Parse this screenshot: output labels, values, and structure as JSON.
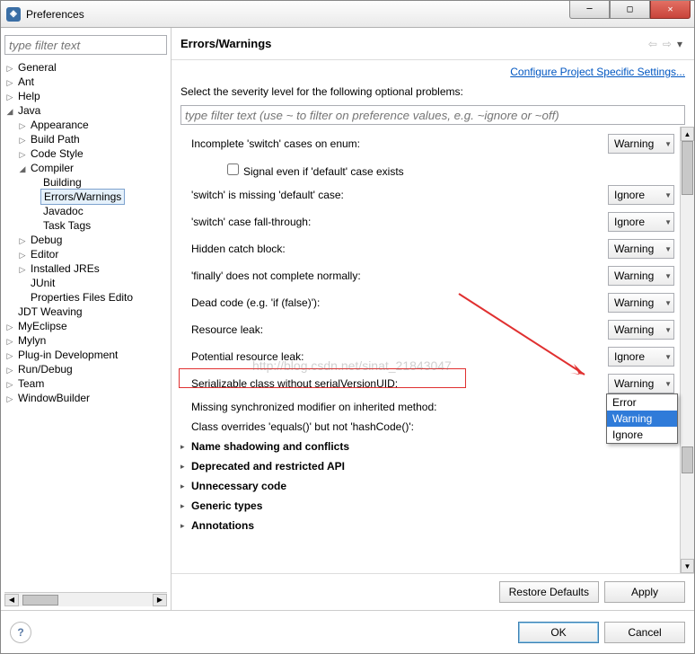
{
  "window": {
    "title": "Preferences"
  },
  "sidebar": {
    "filter_placeholder": "type filter text",
    "items": [
      {
        "label": "General",
        "twisty": "▷",
        "indent": 0
      },
      {
        "label": "Ant",
        "twisty": "▷",
        "indent": 0
      },
      {
        "label": "Help",
        "twisty": "▷",
        "indent": 0
      },
      {
        "label": "Java",
        "twisty": "◢",
        "indent": 0
      },
      {
        "label": "Appearance",
        "twisty": "▷",
        "indent": 1
      },
      {
        "label": "Build Path",
        "twisty": "▷",
        "indent": 1
      },
      {
        "label": "Code Style",
        "twisty": "▷",
        "indent": 1
      },
      {
        "label": "Compiler",
        "twisty": "◢",
        "indent": 1
      },
      {
        "label": "Building",
        "twisty": "",
        "indent": 2
      },
      {
        "label": "Errors/Warnings",
        "twisty": "",
        "indent": 2,
        "selected": true
      },
      {
        "label": "Javadoc",
        "twisty": "",
        "indent": 2
      },
      {
        "label": "Task Tags",
        "twisty": "",
        "indent": 2
      },
      {
        "label": "Debug",
        "twisty": "▷",
        "indent": 1
      },
      {
        "label": "Editor",
        "twisty": "▷",
        "indent": 1
      },
      {
        "label": "Installed JREs",
        "twisty": "▷",
        "indent": 1
      },
      {
        "label": "JUnit",
        "twisty": "",
        "indent": 1
      },
      {
        "label": "Properties Files Edito",
        "twisty": "",
        "indent": 1
      },
      {
        "label": "JDT Weaving",
        "twisty": "",
        "indent": 0
      },
      {
        "label": "MyEclipse",
        "twisty": "▷",
        "indent": 0
      },
      {
        "label": "Mylyn",
        "twisty": "▷",
        "indent": 0
      },
      {
        "label": "Plug-in Development",
        "twisty": "▷",
        "indent": 0
      },
      {
        "label": "Run/Debug",
        "twisty": "▷",
        "indent": 0
      },
      {
        "label": "Team",
        "twisty": "▷",
        "indent": 0
      },
      {
        "label": "WindowBuilder",
        "twisty": "▷",
        "indent": 0
      }
    ]
  },
  "main": {
    "title": "Errors/Warnings",
    "config_link": "Configure Project Specific Settings...",
    "instruction": "Select the severity level for the following optional problems:",
    "filter_placeholder": "type filter text (use ~ to filter on preference values, e.g. ~ignore or ~off)",
    "rows": [
      {
        "label": "Incomplete 'switch' cases on enum:",
        "value": "Warning",
        "indent": 1
      },
      {
        "label": "Signal even if 'default' case exists",
        "checkbox": true,
        "checked": false,
        "indent": 2
      },
      {
        "label": "'switch' is missing 'default' case:",
        "value": "Ignore",
        "indent": 1
      },
      {
        "label": "'switch' case fall-through:",
        "value": "Ignore",
        "indent": 1
      },
      {
        "label": "Hidden catch block:",
        "value": "Warning",
        "indent": 1
      },
      {
        "label": "'finally' does not complete normally:",
        "value": "Warning",
        "indent": 1
      },
      {
        "label": "Dead code (e.g. 'if (false)'):",
        "value": "Warning",
        "indent": 1
      },
      {
        "label": "Resource leak:",
        "value": "Warning",
        "indent": 1
      },
      {
        "label": "Potential resource leak:",
        "value": "Ignore",
        "indent": 1
      },
      {
        "label": "Serializable class without serialVersionUID:",
        "value": "Warning",
        "indent": 1,
        "highlighted": true,
        "dropdown_open": true
      },
      {
        "label": "Missing synchronized modifier on inherited method:",
        "indent": 1
      },
      {
        "label": "Class overrides 'equals()' but not 'hashCode()':",
        "indent": 1
      },
      {
        "label": "Name shadowing and conflicts",
        "section": true
      },
      {
        "label": "Deprecated and restricted API",
        "section": true
      },
      {
        "label": "Unnecessary code",
        "section": true
      },
      {
        "label": "Generic types",
        "section": true
      },
      {
        "label": "Annotations",
        "section": true
      }
    ],
    "dropdown_options": [
      "Error",
      "Warning",
      "Ignore"
    ],
    "dropdown_selected": "Warning"
  },
  "buttons": {
    "restore": "Restore Defaults",
    "apply": "Apply",
    "ok": "OK",
    "cancel": "Cancel"
  },
  "watermark": "http://blog.csdn.net/sinat_21843047"
}
